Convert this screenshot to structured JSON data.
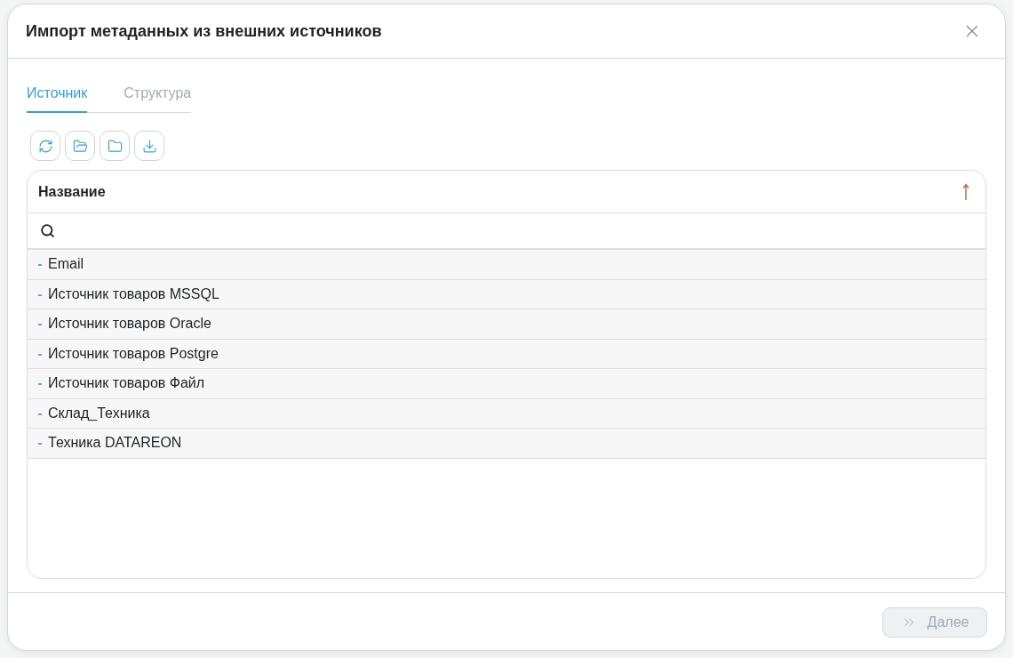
{
  "dialog": {
    "title": "Импорт метаданных из внешних источников"
  },
  "tabs": [
    {
      "label": "Источник",
      "selected": true
    },
    {
      "label": "Структура",
      "selected": false
    }
  ],
  "toolbar": [
    {
      "kind": "refresh"
    },
    {
      "kind": "open-folder"
    },
    {
      "kind": "folder"
    },
    {
      "kind": "download"
    }
  ],
  "table": {
    "columns": [
      {
        "label": "Название",
        "sorted": true
      }
    ],
    "rows": [
      {
        "name": "Email"
      },
      {
        "name": "Источник товаров MSSQL"
      },
      {
        "name": "Источник товаров Oracle"
      },
      {
        "name": "Источник товаров Postgre"
      },
      {
        "name": "Источник товаров Файл"
      },
      {
        "name": "Склад_Техника"
      },
      {
        "name": "Техника DATAREON"
      }
    ]
  },
  "footer": {
    "buttons": [
      {
        "label": "Далее",
        "disabled": true
      }
    ]
  }
}
